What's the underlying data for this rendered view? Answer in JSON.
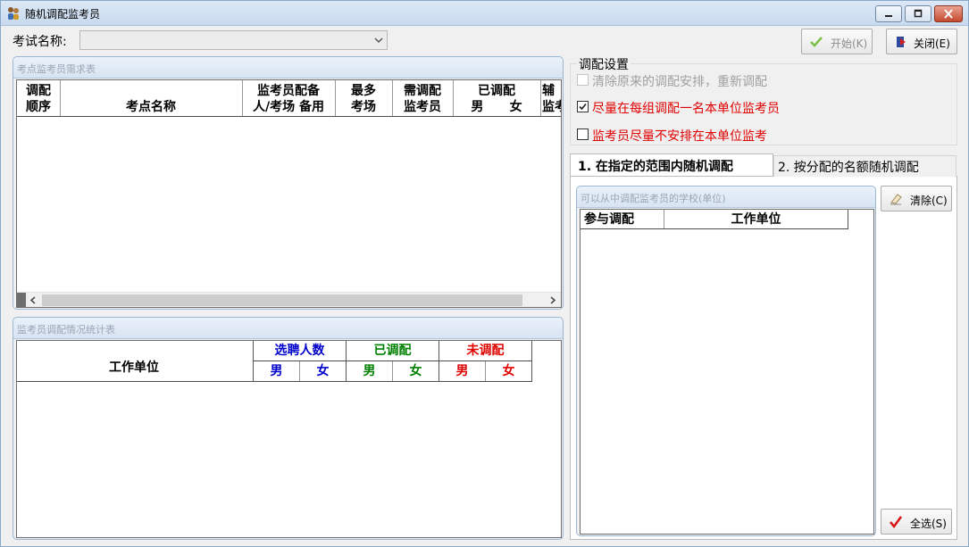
{
  "window": {
    "title": "随机调配监考员",
    "controls": [
      "minimize-icon",
      "maximize-icon",
      "close-icon"
    ]
  },
  "exam": {
    "label": "考试名称:",
    "value": ""
  },
  "toolbar": {
    "start_label": "开始(K)",
    "close_label": "关闭(E)"
  },
  "demand_table": {
    "title": "考点监考员需求表",
    "columns": [
      {
        "line1": "调配",
        "line2": "顺序"
      },
      {
        "line1": "",
        "line2": "考点名称"
      },
      {
        "line1": "监考员配备",
        "line2": "人/考场 备用"
      },
      {
        "line1": "最多",
        "line2": "考场"
      },
      {
        "line1": "需调配",
        "line2": "监考员"
      },
      {
        "line1": "已调配",
        "line2": "男      女"
      },
      {
        "line1": "辅",
        "line2": "监考"
      }
    ],
    "rows": []
  },
  "stats_table": {
    "title": "监考员调配情况统计表",
    "unit_header": "工作单位",
    "groups": [
      {
        "label": "选聘人数",
        "male": "男",
        "female": "女",
        "color": "#0000cc"
      },
      {
        "label": "已调配",
        "male": "男",
        "female": "女",
        "color": "#008000"
      },
      {
        "label": "未调配",
        "male": "男",
        "female": "女",
        "color": "#e00000"
      }
    ],
    "rows": []
  },
  "settings": {
    "title": "调配设置",
    "options": [
      {
        "label": "清除原来的调配安排，重新调配",
        "checked": false,
        "disabled": true,
        "color": "#a0a0a0"
      },
      {
        "label": "尽量在每组调配一名本单位监考员",
        "checked": true,
        "disabled": false,
        "color": "#e00000"
      },
      {
        "label": "监考员尽量不安排在本单位监考",
        "checked": false,
        "disabled": false,
        "color": "#e00000"
      }
    ]
  },
  "tabs": [
    {
      "label": "1. 在指定的范围内随机调配",
      "active": true
    },
    {
      "label": "2. 按分配的名额随机调配",
      "active": false
    }
  ],
  "school_table": {
    "title": "可以从中调配监考员的学校(单位)",
    "columns": [
      "参与调配",
      "工作单位"
    ],
    "rows": []
  },
  "side_buttons": {
    "clear_label": "清除(C)",
    "select_all_label": "全选(S)"
  }
}
